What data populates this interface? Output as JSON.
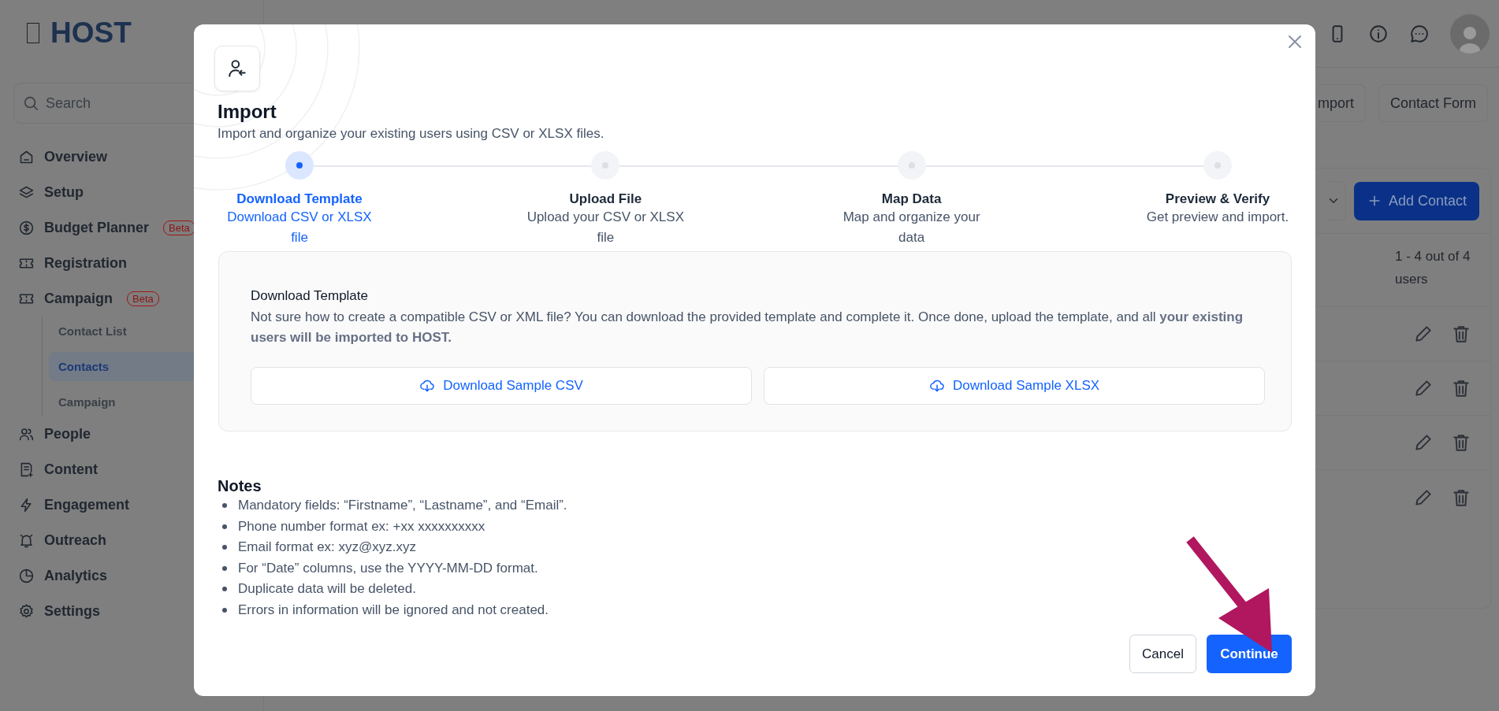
{
  "app": {
    "logo": "HOST",
    "search": {
      "placeholder": "Search"
    }
  },
  "sidebar": {
    "items": [
      {
        "label": "Overview",
        "selected": false
      },
      {
        "label": "Setup",
        "selected": false
      },
      {
        "label": "Budget Planner",
        "badge": "Beta",
        "selected": false
      },
      {
        "label": "Registration",
        "selected": false
      },
      {
        "label": "Campaign",
        "badge": "Beta",
        "selected": false,
        "children": [
          {
            "label": "Contact List",
            "selected": false
          },
          {
            "label": "Contacts",
            "selected": true
          },
          {
            "label": "Campaign",
            "selected": false
          }
        ]
      },
      {
        "label": "People",
        "selected": false
      },
      {
        "label": "Content",
        "selected": false
      },
      {
        "label": "Engagement",
        "selected": false
      },
      {
        "label": "Outreach",
        "selected": false
      },
      {
        "label": "Analytics",
        "selected": false
      },
      {
        "label": "Settings",
        "selected": false
      }
    ]
  },
  "toolbar": {
    "buttons": [
      "mport",
      "Contact Form"
    ]
  },
  "contacts": {
    "add_button": "Add Contact",
    "count": "1 - 4 out of 4 users",
    "rows": [
      {
        "kind": "actions"
      },
      {
        "kind": "actions"
      },
      {
        "kind": "actions"
      },
      {
        "kind": "actions"
      }
    ]
  },
  "modal": {
    "title": "Import",
    "subtitle": "Import and organize your existing users using CSV or XLSX files.",
    "steps": [
      {
        "title": "Download Template",
        "description": "Download CSV or XLSX file",
        "selected": true
      },
      {
        "title": "Upload File",
        "description": "Upload your CSV or XLSX file",
        "selected": false
      },
      {
        "title": "Map Data",
        "description": "Map and organize your data",
        "selected": false
      },
      {
        "title": "Preview & Verify",
        "description": "Get preview and import.",
        "selected": false
      }
    ],
    "panel": {
      "title": "Download Template",
      "text": "Not sure how to create a compatible CSV or XML file? You can download the provided template and complete it. Once done, upload the template, and all **your existing users will be imported to HOST.**",
      "buttons": [
        "Download Sample CSV",
        "Download Sample XLSX"
      ]
    },
    "notes": {
      "title": "Notes",
      "items": [
        "Mandatory fields: “Firstname”, “Lastname”, and “Email”.",
        "Phone number format ex: +xx xxxxxxxxxx",
        "Email format ex: xyz@xyz.xyz",
        "For “Date” columns, use the YYYY-MM-DD format.",
        "Duplicate data will be deleted.",
        "Errors in information will be ignored and not created."
      ]
    },
    "buttons": [
      {
        "label": "Cancel",
        "kind": "secondary"
      },
      {
        "label": "Continue",
        "kind": "primary"
      }
    ]
  }
}
